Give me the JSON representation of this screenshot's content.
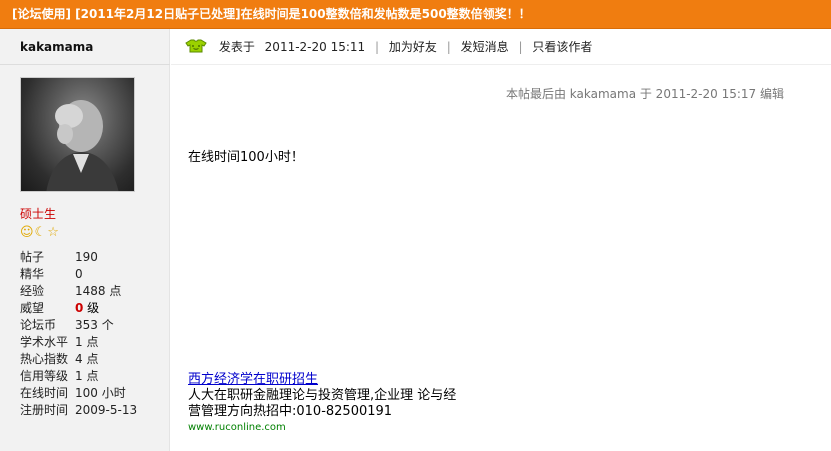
{
  "thread": {
    "title": "[论坛使用] [2011年2月12日贴子已处理]在线时间是100整数倍和发帖数是500整数倍领奖！！"
  },
  "author": {
    "username": "kakamama",
    "rank": "硕士生",
    "stars": "☺☾☆",
    "stats": [
      {
        "label": "帖子",
        "value": "190"
      },
      {
        "label": "精华",
        "value": "0"
      },
      {
        "label": "经验",
        "value": "1488 点"
      },
      {
        "label": "威望",
        "value": "0",
        "unit": " 级"
      },
      {
        "label": "论坛币",
        "value": "353 个"
      },
      {
        "label": "学术水平",
        "value": "1 点"
      },
      {
        "label": "热心指数",
        "value": "4 点"
      },
      {
        "label": "信用等级",
        "value": "1 点"
      },
      {
        "label": "在线时间",
        "value": "100 小时"
      },
      {
        "label": "注册时间",
        "value": "2009-5-13"
      }
    ]
  },
  "post": {
    "posted_label": "发表于",
    "posted_at": "2011-2-20 15:11",
    "actions": [
      "加为好友",
      "发短消息",
      "只看该作者"
    ],
    "edit_note": "本帖最后由  kakamama 于  2011-2-20 15:17 编辑",
    "body": "在线时间100小时！"
  },
  "ad": {
    "title": "西方经济学在职研招生",
    "line1": "人大在职研金融理论与投资管理,企业理 论与经",
    "line2": "营管理方向热招中:010-82500191",
    "url": "www.ruconline.com"
  },
  "colors": {
    "title_bar": "#f07d10",
    "rank": "#cc0000",
    "link": "#0000cc",
    "ad_url": "#008000"
  },
  "icons": {
    "post_icon": "shirt-icon"
  }
}
